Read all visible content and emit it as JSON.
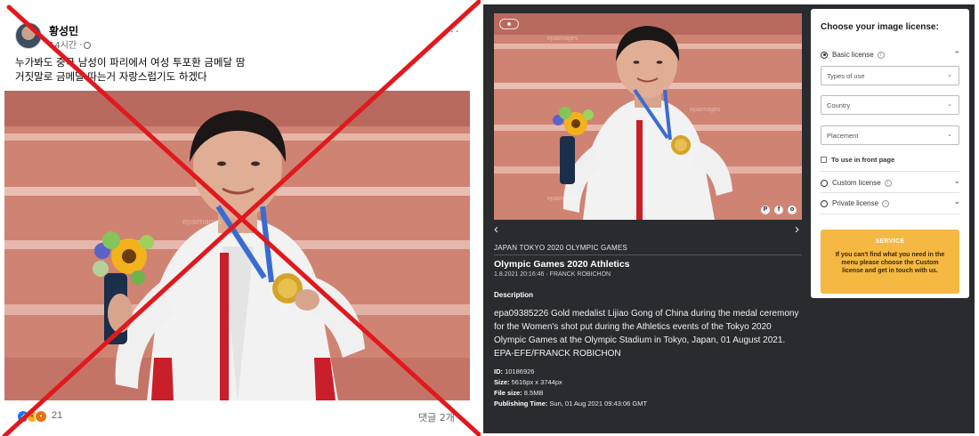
{
  "facebook_post": {
    "author_name": "황성민",
    "time": "14시간 ·",
    "more": "···",
    "text_line1": "누가봐도 중국 남성이 파리에서 여성 투포환 금메달 땀",
    "text_line2": "거짓말로 금메달 따는거 자랑스럽기도 하겠다",
    "reaction_count": "21",
    "comments": "댓글 2개"
  },
  "watermark": {
    "text": "epaimages"
  },
  "agency": {
    "category": "JAPAN TOKYO 2020 OLYMPIC GAMES",
    "title": "Olympic Games 2020 Athletics",
    "meta": "1.8.2021 20:16:46 · FRANCK ROBICHON",
    "description_label": "Description",
    "description": "epa09385226 Gold medalist Lijiao Gong of China during the medal ceremony for the Women's shot put during the Athletics events of the Tokyo 2020 Olympic Games at the Olympic Stadium in Tokyo, Japan, 01 August 2021. EPA-EFE/FRANCK ROBICHON",
    "id_label": "ID:",
    "id_value": "10186926",
    "size_label": "Size:",
    "size_value": "5616px x 3744px",
    "filesize_label": "File size:",
    "filesize_value": "8.5MB",
    "publishing_label": "Publishing Time:",
    "publishing_value": "Sun, 01 Aug 2021 09:43:06 GMT"
  },
  "license": {
    "title": "Choose your image license:",
    "basic": "Basic license",
    "types_of_use": "Types of use",
    "country": "Country",
    "placement": "Placement",
    "front_page": "To use in front page",
    "custom": "Custom license",
    "private": "Private license",
    "service_label": "SERVICE",
    "service_text": "If you can't find what you need in the menu please choose the Custom license and get in touch with us."
  },
  "colors": {
    "cross": "#e0191f",
    "agency_bg": "#2a2b2f",
    "service_bg": "#f4b843",
    "facebook_blue": "#1877f2"
  },
  "icons": [
    "globe-icon",
    "like-reaction-icon",
    "sad-reaction-icon",
    "angry-reaction-icon",
    "info-icon",
    "chevron-down-icon",
    "arrow-left-icon",
    "arrow-right-icon",
    "pinterest-icon",
    "facebook-icon",
    "instagram-icon"
  ]
}
